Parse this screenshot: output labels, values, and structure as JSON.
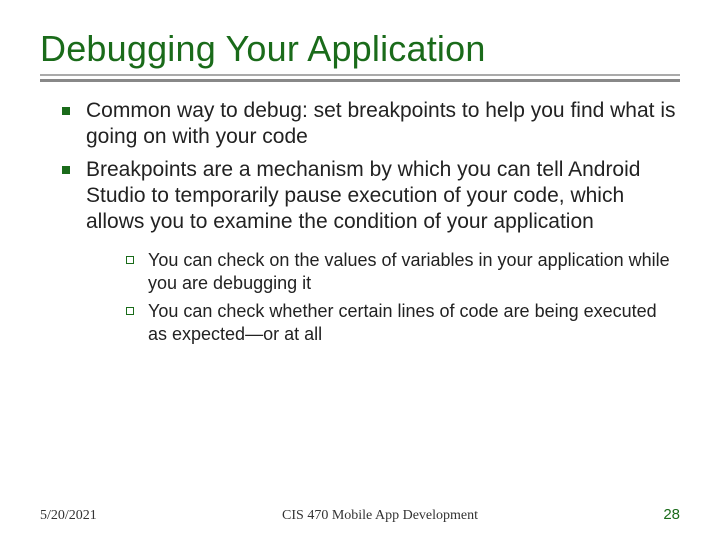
{
  "title": "Debugging Your Application",
  "bullets": {
    "b0": "Common way to debug: set breakpoints to help you find what is going on with your code",
    "b1": "Breakpoints are a mechanism by which you can tell Android Studio to temporarily pause execution of your code, which allows you to examine the condition of your application"
  },
  "subbullets": {
    "s0": "You can check on the values of variables in your application while you are debugging it",
    "s1": "You can check whether certain lines of code are being executed as expected—or at all"
  },
  "footer": {
    "date": "5/20/2021",
    "course": "CIS 470 Mobile App Development",
    "page": "28"
  }
}
